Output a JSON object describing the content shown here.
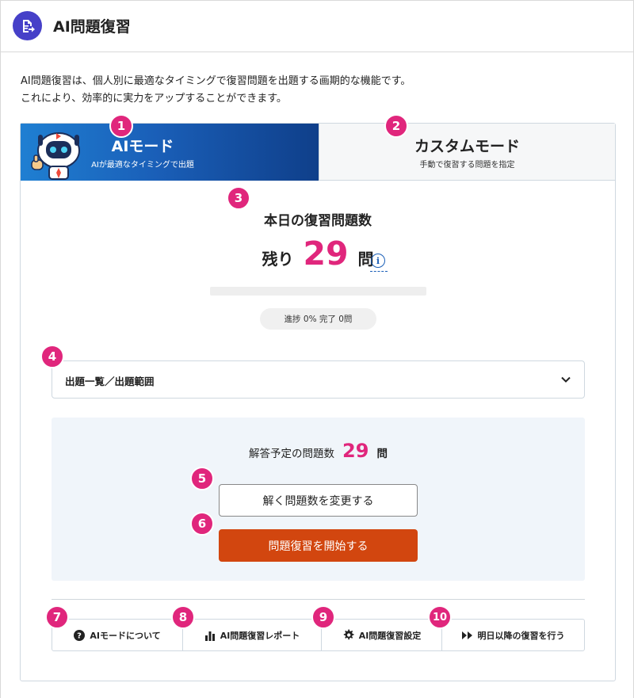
{
  "header": {
    "title": "AI問題復習",
    "icon": "document-arrow-icon"
  },
  "intro": {
    "line1": "AI問題復習は、個人別に最適なタイミングで復習問題を出題する画期的な機能です。",
    "line2": "これにより、効率的に実力をアップすることができます。"
  },
  "tabs": {
    "ai": {
      "title": "AIモード",
      "subtitle": "AIが最適なタイミングで出題",
      "selected": true
    },
    "custom": {
      "title": "カスタムモード",
      "subtitle": "手動で復習する問題を指定",
      "selected": false
    }
  },
  "today": {
    "title": "本日の復習問題数",
    "prefix": "残り",
    "count": "29",
    "unit": "問",
    "progress_fraction": 0,
    "progress_text": "進捗 0%  完了 0問"
  },
  "accordion": {
    "label": "出題一覧／出題範囲"
  },
  "planned": {
    "label": "解答予定の問題数",
    "count": "29",
    "unit": "問"
  },
  "buttons": {
    "change": "解く問題数を変更する",
    "start": "問題復習を開始する"
  },
  "bottom": [
    {
      "label": "AIモードについて",
      "icon": "question-circle-icon"
    },
    {
      "label": "AI問題復習レポート",
      "icon": "bar-chart-icon"
    },
    {
      "label": "AI問題復習設定",
      "icon": "gear-icon"
    },
    {
      "label": "明日以降の復習を行う",
      "icon": "fast-forward-icon"
    }
  ],
  "badges": [
    "1",
    "2",
    "3",
    "4",
    "5",
    "6",
    "7",
    "8",
    "9",
    "10"
  ],
  "colors": {
    "accent": "#e0267c",
    "primary": "#1a5fb8",
    "start_button": "#d2460f",
    "header_icon": "#4640c8"
  }
}
